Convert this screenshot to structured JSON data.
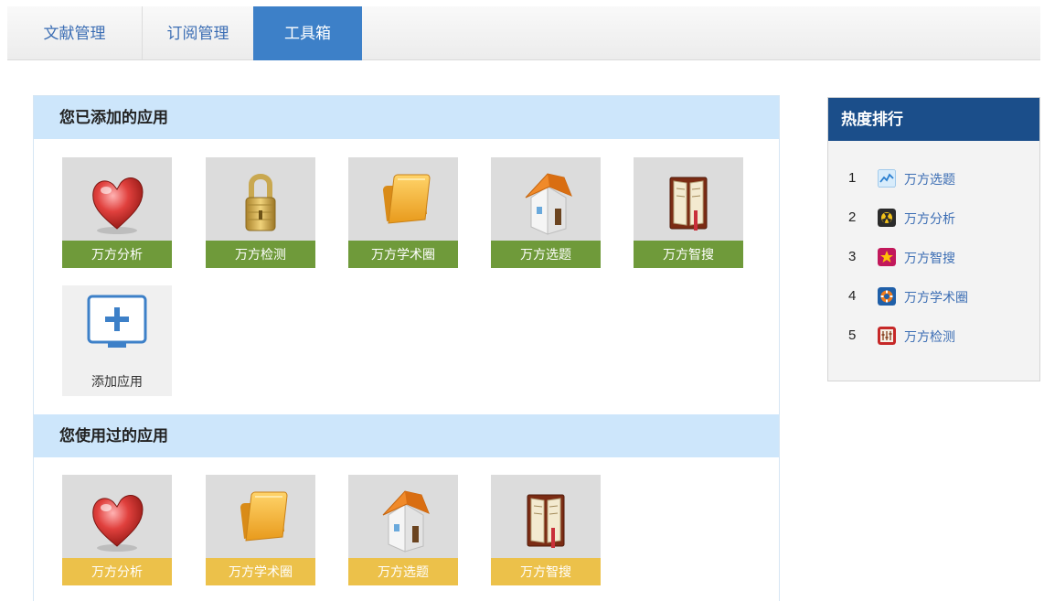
{
  "tabs": [
    {
      "label": "文献管理"
    },
    {
      "label": "订阅管理"
    },
    {
      "label": "工具箱"
    }
  ],
  "added_section": {
    "title": "您已添加的应用",
    "apps": [
      {
        "label": "万方分析",
        "icon": "heart-icon"
      },
      {
        "label": "万方检测",
        "icon": "padlock-icon"
      },
      {
        "label": "万方学术圈",
        "icon": "folder-icon"
      },
      {
        "label": "万方选题",
        "icon": "house-icon"
      },
      {
        "label": "万方智搜",
        "icon": "book-icon"
      }
    ],
    "add_label": "添加应用"
  },
  "used_section": {
    "title": "您使用过的应用",
    "apps": [
      {
        "label": "万方分析",
        "icon": "heart-icon"
      },
      {
        "label": "万方学术圈",
        "icon": "folder-icon"
      },
      {
        "label": "万方选题",
        "icon": "house-icon"
      },
      {
        "label": "万方智搜",
        "icon": "book-icon"
      }
    ]
  },
  "ranking": {
    "title": "热度排行",
    "items": [
      {
        "rank": "1",
        "label": "万方选题",
        "icon": "trend-chart-icon"
      },
      {
        "rank": "2",
        "label": "万方分析",
        "icon": "radiation-icon"
      },
      {
        "rank": "3",
        "label": "万方智搜",
        "icon": "star-icon"
      },
      {
        "rank": "4",
        "label": "万方学术圈",
        "icon": "lifebuoy-icon"
      },
      {
        "rank": "5",
        "label": "万方检测",
        "icon": "meter-icon"
      }
    ]
  },
  "colors": {
    "tab_active": "#3d80c8",
    "section_header_bg": "#cde6fb",
    "label_green": "#6f9a3a",
    "label_yellow": "#ecc14a",
    "ranking_header": "#1b4e8a",
    "link_blue": "#3c6eb4"
  }
}
